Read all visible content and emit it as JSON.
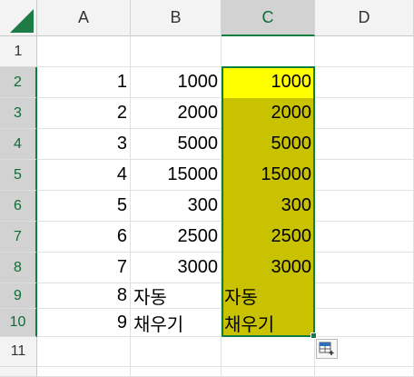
{
  "columns": [
    "A",
    "B",
    "C",
    "D"
  ],
  "rows": [
    "1",
    "2",
    "3",
    "4",
    "5",
    "6",
    "7",
    "8",
    "9",
    "10",
    "11"
  ],
  "cells": {
    "a2": "1",
    "a3": "2",
    "a4": "3",
    "a5": "4",
    "a6": "5",
    "a7": "6",
    "a8": "7",
    "a9": "8",
    "a10": "9",
    "b2": "1000",
    "b3": "2000",
    "b4": "5000",
    "b5": "15000",
    "b6": "300",
    "b7": "2500",
    "b8": "3000",
    "b9": "자동",
    "b10": "채우기",
    "c2": "1000",
    "c3": "2000",
    "c4": "5000",
    "c5": "15000",
    "c6": "300",
    "c7": "2500",
    "c8": "3000",
    "c9": "자동",
    "c10": "채우기"
  },
  "colors": {
    "accent": "#107c41",
    "highlight_yellow": "#ffff00",
    "highlight_olive": "#c9c200"
  },
  "icons": {
    "autofill_options": "auto-fill-options-icon"
  }
}
